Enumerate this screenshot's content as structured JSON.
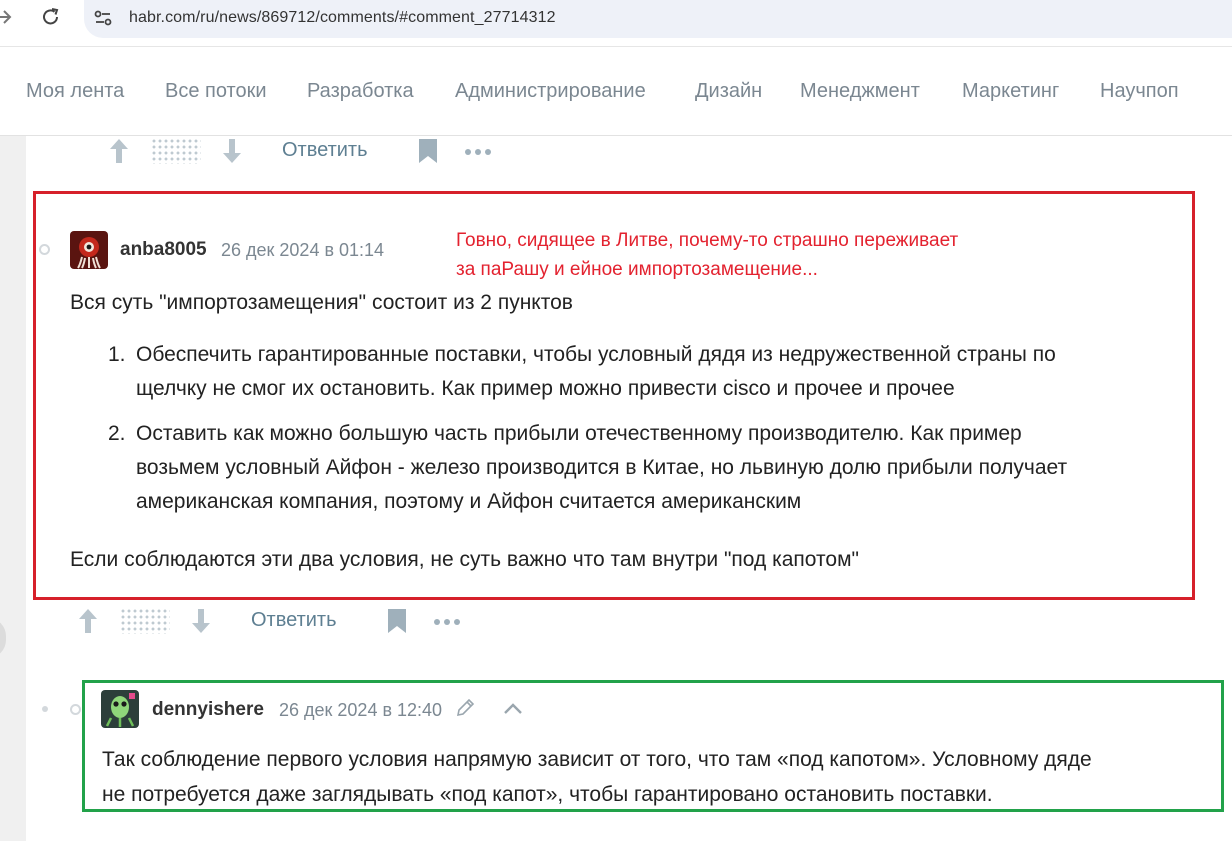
{
  "browser": {
    "url": "habr.com/ru/news/869712/comments/#comment_27714312",
    "back_icon": "arrow-right-icon",
    "reload_icon": "reload-icon",
    "site_info_icon": "tune-icon"
  },
  "header": {
    "nav": [
      {
        "label": "Моя лента"
      },
      {
        "label": "Все потоки"
      },
      {
        "label": "Разработка"
      },
      {
        "label": "Администрирование"
      },
      {
        "label": "Дизайн"
      },
      {
        "label": "Менеджмент"
      },
      {
        "label": "Маркетинг"
      },
      {
        "label": "Научпоп"
      }
    ]
  },
  "actions": {
    "reply_label": "Ответить"
  },
  "comment1": {
    "username": "anba8005",
    "date": "26 дек 2024 в 01:14",
    "annotation_line1": "Говно, сидящее в Литве, почему-то страшно переживает",
    "annotation_line2": "за паРашу и ейное импортозамещение...",
    "intro": "Вся суть \"импортозамещения\" состоит из 2 пунктов",
    "items": [
      {
        "num": "1.",
        "line1": "Обеспечить гарантированные поставки, чтобы условный дядя из недружественной страны по",
        "line2": "щелчку не смог их остановить. Как пример можно привести cisco и прочее и прочее",
        "line3": ""
      },
      {
        "num": "2.",
        "line1": "Оставить как можно большую часть прибыли отечественному производителю. Как пример",
        "line2": "возьмем условный Айфон - железо производится в Китае, но львиную долю прибыли получает",
        "line3": "американская компания, поэтому и Айфон считается американским"
      }
    ],
    "conclusion": "Если соблюдаются эти два условия, не суть важно что там внутри \"под капотом\""
  },
  "comment2": {
    "username": "dennyishere",
    "date": "26 дек 2024 в 12:40",
    "line1": "Так соблюдение первого условия напрямую зависит от того, что там «под капотом». Условному дяде",
    "line2": "не потребуется даже заглядывать «под капот», чтобы гарантировано остановить поставки."
  },
  "colors": {
    "red_frame": "#d6202a",
    "green_frame": "#22a24a",
    "annotation": "#e3222f",
    "reply_link": "#5e7f92",
    "nav_text": "#7b8791"
  }
}
